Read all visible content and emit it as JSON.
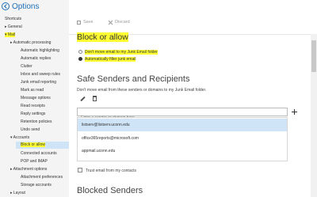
{
  "app": {
    "title": "Options"
  },
  "sidebar": {
    "items": [
      {
        "label": "Shortcuts"
      },
      {
        "label": "▸ General"
      },
      {
        "label": "▾ Mail"
      },
      {
        "label": "▸ Automatic processing"
      },
      {
        "label": "Automatic highlighting"
      },
      {
        "label": "Automatic replies"
      },
      {
        "label": "Clutter"
      },
      {
        "label": "Inbox and sweep rules"
      },
      {
        "label": "Junk email reporting"
      },
      {
        "label": "Mark as read"
      },
      {
        "label": "Message options"
      },
      {
        "label": "Read receipts"
      },
      {
        "label": "Reply settings"
      },
      {
        "label": "Retention policies"
      },
      {
        "label": "Undo send"
      },
      {
        "label": "▾ Accounts"
      },
      {
        "label": "Block or allow"
      },
      {
        "label": "Connected accounts"
      },
      {
        "label": "POP and IMAP"
      },
      {
        "label": "▸ Attachment options"
      },
      {
        "label": "Attachment preferences"
      },
      {
        "label": "Storage accounts"
      },
      {
        "label": "▸ Layout"
      }
    ]
  },
  "toolbar": {
    "save_label": "Save",
    "discard_label": "Discard"
  },
  "block": {
    "heading": "Block or allow",
    "option1": "Don't move email to my Junk Email folder",
    "option2": "Automatically filter junk email"
  },
  "safe": {
    "heading": "Safe Senders and Recipients",
    "description": "Don't move email from these senders or domains to my Junk Email folder.",
    "input_placeholder": "Enter a sender or domain here",
    "entries": [
      "listserv@listserv.uconn.edu",
      "office365reports@microsoft.com",
      "appmail.uconn.edu"
    ],
    "trust_label": "Trust email from my contacts"
  },
  "blocked": {
    "heading": "Blocked Senders"
  },
  "colors": {
    "accent": "#1d6fb8",
    "highlight": "#ffff33",
    "selected": "#cfe4f7"
  }
}
